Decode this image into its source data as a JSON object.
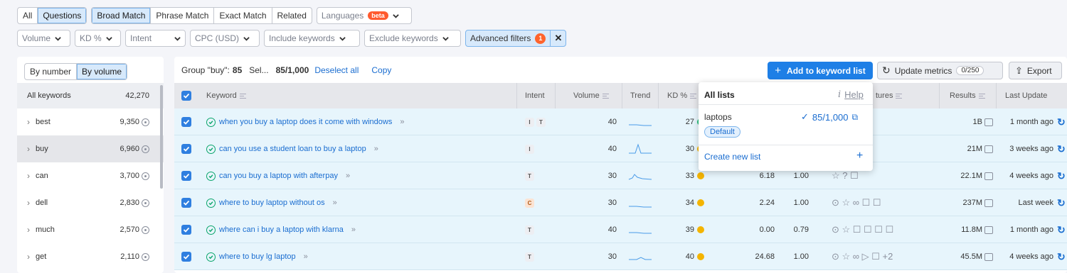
{
  "filters_row1": {
    "scope": [
      "All",
      "Questions"
    ],
    "match": [
      "Broad Match",
      "Phrase Match",
      "Exact Match",
      "Related"
    ],
    "languages_label": "Languages",
    "beta_badge": "beta"
  },
  "filters_row2": {
    "volume": "Volume",
    "kd": "KD %",
    "intent": "Intent",
    "cpc": "CPC (USD)",
    "include": "Include keywords",
    "exclude": "Exclude keywords",
    "advanced": "Advanced filters",
    "advanced_count": "1"
  },
  "left_panel": {
    "toggle": [
      "By number",
      "By volume"
    ],
    "header_label": "All keywords",
    "header_value": "42,270",
    "groups": [
      {
        "name": "best",
        "value": "9,350"
      },
      {
        "name": "buy",
        "value": "6,960"
      },
      {
        "name": "can",
        "value": "3,700"
      },
      {
        "name": "dell",
        "value": "2,830"
      },
      {
        "name": "much",
        "value": "2,570"
      },
      {
        "name": "get",
        "value": "2,110"
      }
    ]
  },
  "toolbar": {
    "group_prefix": "Group \"buy\":",
    "group_count": "85",
    "selected_prefix": "Sel...",
    "selected_count": "85/1,000",
    "deselect": "Deselect all",
    "copy": "Copy",
    "add_to_list": "Add to keyword list",
    "update_metrics": "Update metrics",
    "update_count": "0/250",
    "export": "Export"
  },
  "table": {
    "headers": {
      "keyword": "Keyword",
      "intent": "Intent",
      "volume": "Volume",
      "trend": "Trend",
      "kd": "KD %",
      "features": "tures",
      "results": "Results",
      "last_update": "Last Update"
    },
    "rows": [
      {
        "keyword": "when you buy a laptop does it come with windows",
        "intents": [
          "I",
          "T"
        ],
        "volume": "40",
        "kd": "27",
        "kd_color": "green",
        "cpc": "",
        "com": "",
        "features": "☐ ☐",
        "results": "1B",
        "updated": "1 month ago"
      },
      {
        "keyword": "can you use a student loan to buy a laptop",
        "intents": [
          "I"
        ],
        "volume": "40",
        "kd": "30",
        "kd_color": "yellow",
        "cpc": "",
        "com": "",
        "features": "",
        "results": "21M",
        "updated": "3 weeks ago"
      },
      {
        "keyword": "can you buy a laptop with afterpay",
        "intents": [
          "T"
        ],
        "volume": "30",
        "kd": "33",
        "kd_color": "yellow",
        "cpc": "6.18",
        "com": "1.00",
        "features": "☆ ? ☐",
        "results": "22.1M",
        "updated": "4 weeks ago"
      },
      {
        "keyword": "where to buy laptop without os",
        "intents": [
          "C"
        ],
        "volume": "30",
        "kd": "34",
        "kd_color": "yellow",
        "cpc": "2.24",
        "com": "1.00",
        "features": "⊙ ☆ ∞ ☐ ☐",
        "results": "237M",
        "updated": "Last week"
      },
      {
        "keyword": "where can i buy a laptop with klarna",
        "intents": [
          "T"
        ],
        "volume": "40",
        "kd": "39",
        "kd_color": "yellow",
        "cpc": "0.00",
        "com": "0.79",
        "features": "⊙ ☆ ☐ ☐ ☐ ☐",
        "results": "11.8M",
        "updated": "1 month ago"
      },
      {
        "keyword": "where to buy lg laptop",
        "intents": [
          "T"
        ],
        "volume": "30",
        "kd": "40",
        "kd_color": "yellow",
        "cpc": "24.68",
        "com": "1.00",
        "features": "⊙ ☆ ∞ ▷ ☐ +2",
        "results": "45.5M",
        "updated": "4 weeks ago"
      }
    ]
  },
  "popup": {
    "title": "All lists",
    "help": "Help",
    "list_name": "laptops",
    "list_count": "85/1,000",
    "default_badge": "Default",
    "create_new": "Create new list"
  }
}
